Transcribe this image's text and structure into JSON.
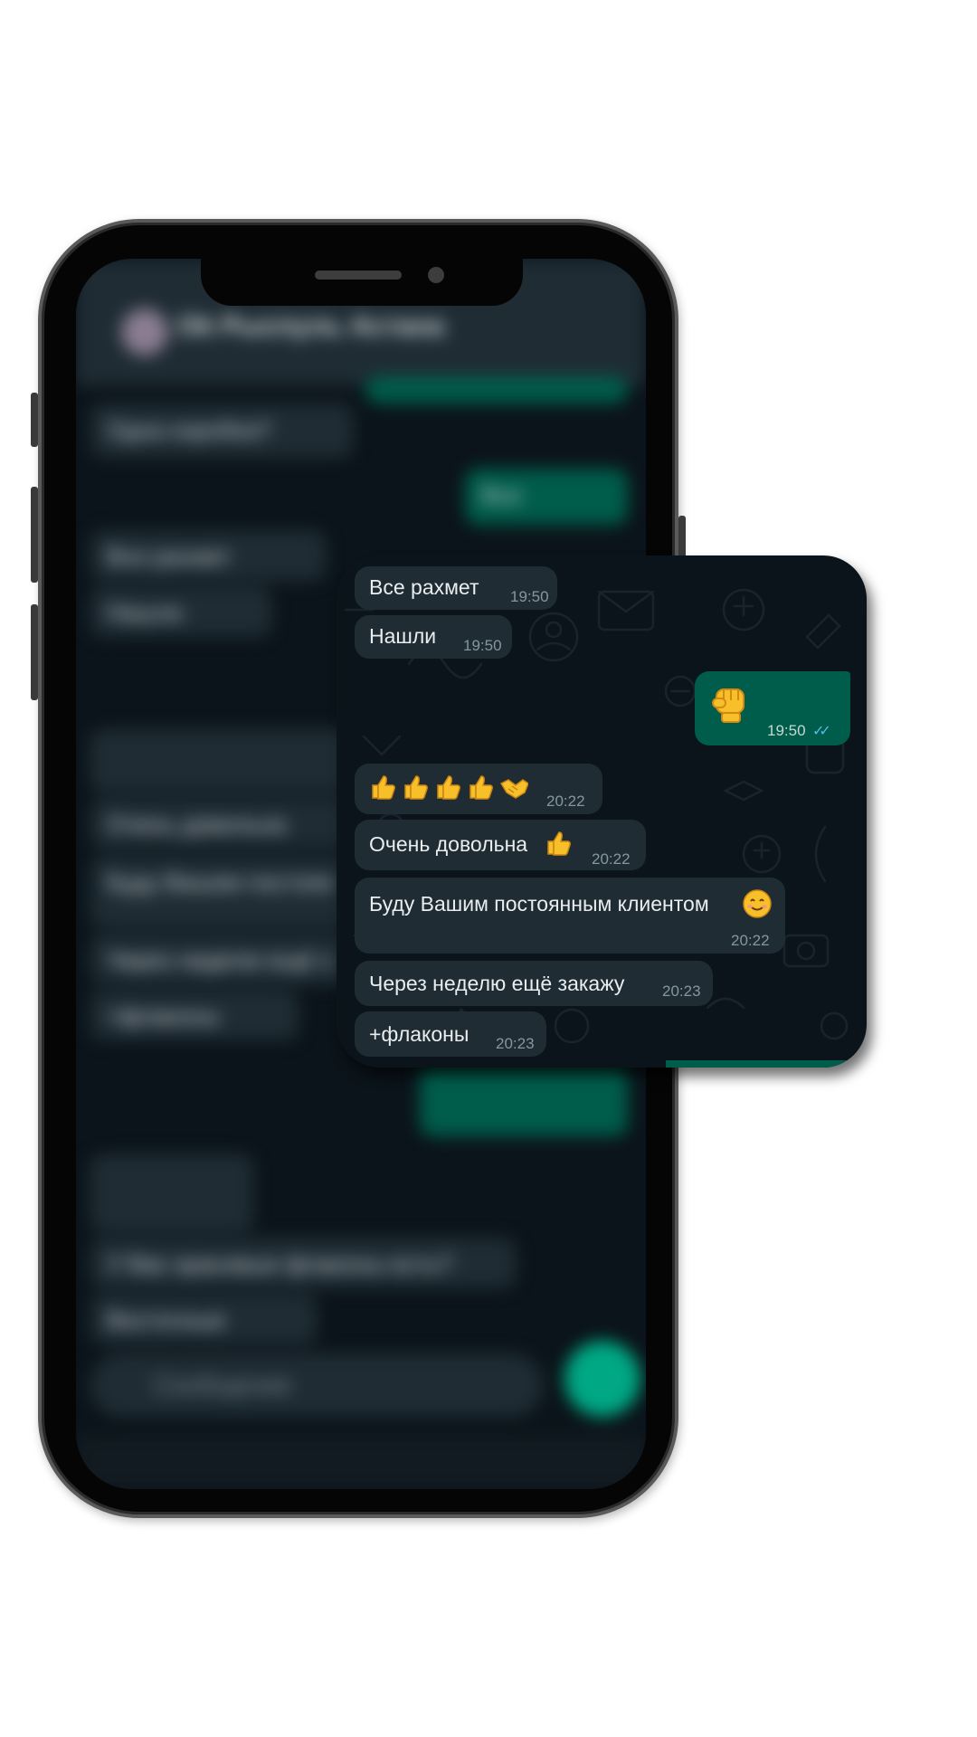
{
  "background_chat": {
    "contact_name": "Ok Рыспуль Астана",
    "input_placeholder": "Сообщение",
    "bubbles": [
      "Одна коробка?",
      "Все",
      "Все рахмет",
      "Нашли",
      "Очень довольна",
      "Буду Вашим постоян",
      "Через неделю ещё з",
      "+флаконы",
      "У Вас красивые флаконы есть?",
      "Восточные"
    ]
  },
  "popup_chat": {
    "messages": [
      {
        "direction": "in",
        "text": "Все рахмет",
        "time": "19:50"
      },
      {
        "direction": "in",
        "text": "Нашли",
        "time": "19:50"
      },
      {
        "direction": "out",
        "emoji": "raised-fist",
        "time": "19:50",
        "read": true
      },
      {
        "direction": "in",
        "emoji": "thumbs-up-x4-handshake",
        "time": "20:22"
      },
      {
        "direction": "in",
        "text": "Очень довольна",
        "emoji": "thumbs-up",
        "time": "20:22"
      },
      {
        "direction": "in",
        "text": "Буду Вашим постоянным клиентом",
        "emoji": "smiling-face",
        "time": "20:22"
      },
      {
        "direction": "in",
        "text": "Через неделю ещё закажу",
        "time": "20:23"
      },
      {
        "direction": "in",
        "text": "+флаконы",
        "time": "20:23"
      }
    ]
  },
  "colors": {
    "chat_background": "#0b141a",
    "incoming_bubble": "#1f2c34",
    "outgoing_bubble": "#005c4b",
    "read_ticks": "#53bdeb",
    "accent_green": "#00a884"
  }
}
